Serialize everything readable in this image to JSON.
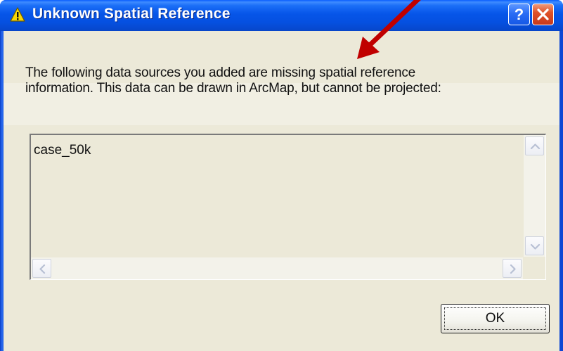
{
  "window": {
    "title": "Unknown Spatial Reference",
    "title_icon": "warning-icon",
    "help_glyph": "?",
    "close_glyph": "✕"
  },
  "message": {
    "line1": "The following data sources you added are missing spatial reference",
    "line2": "information. This data can be drawn in ArcMap, but cannot be projected:"
  },
  "list": {
    "items": [
      "case_50k"
    ]
  },
  "buttons": {
    "ok_label": "OK"
  },
  "colors": {
    "titlebar_blue": "#0655e8",
    "close_red": "#e0532a",
    "dialog_face": "#ece9d8",
    "annotation_arrow": "#c00000"
  }
}
